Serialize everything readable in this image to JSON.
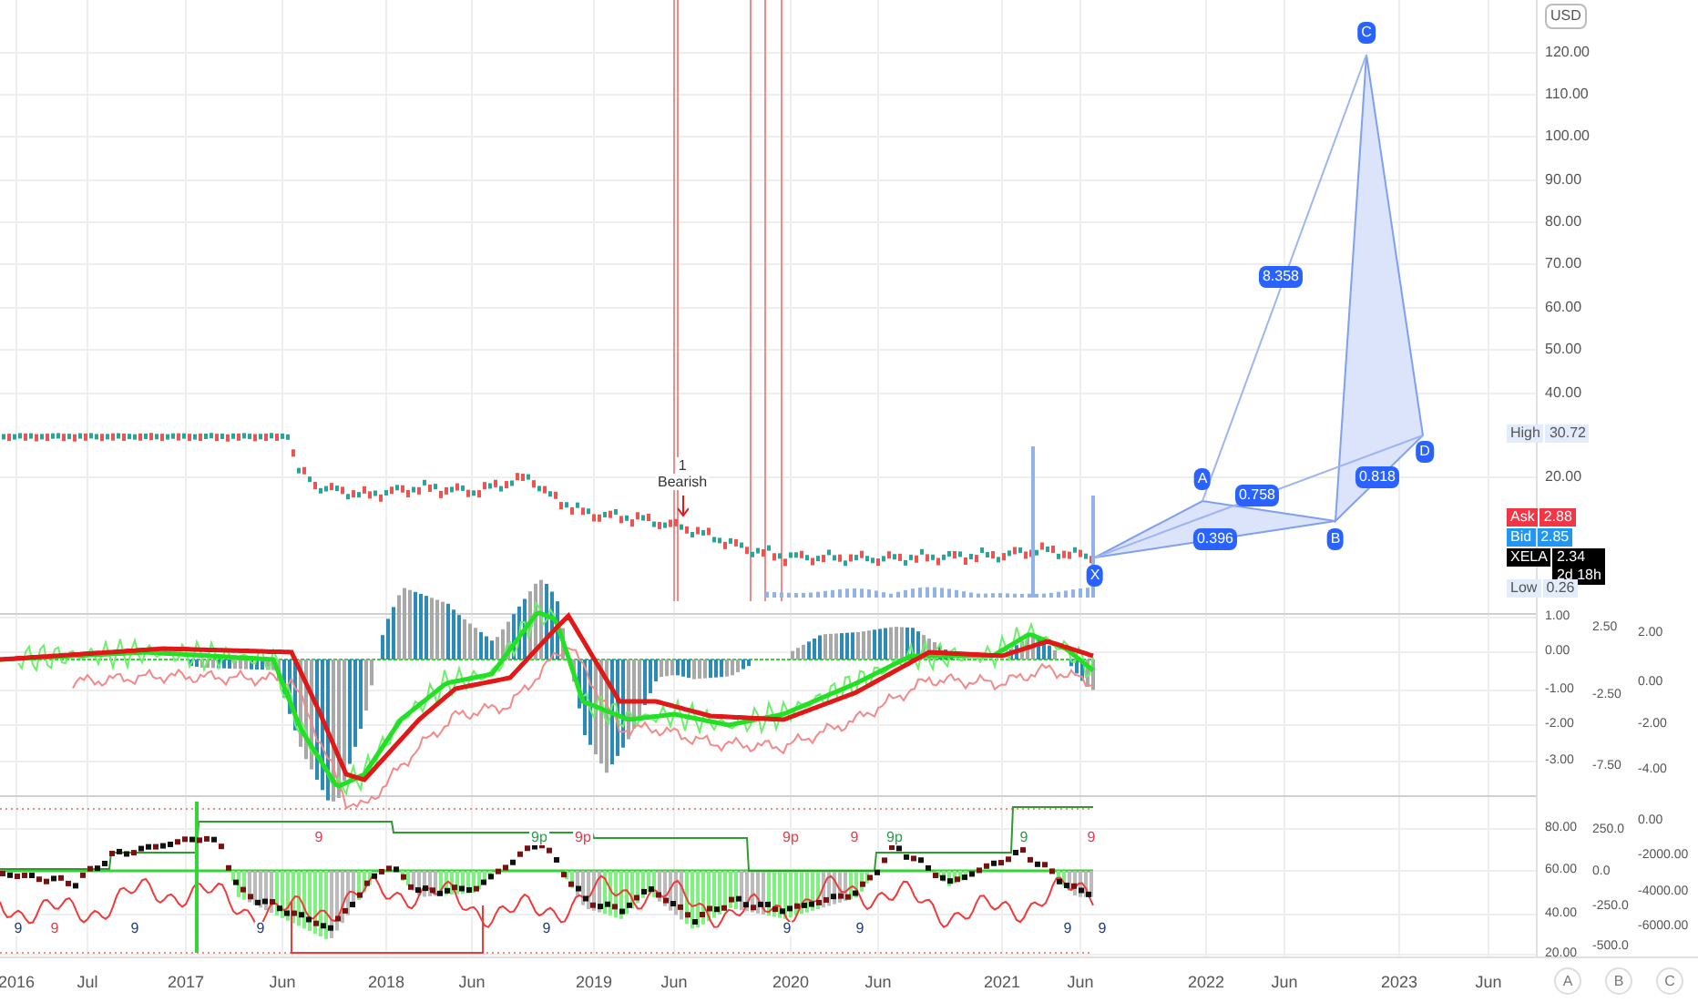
{
  "price_axis": {
    "currency": "USD",
    "ticks": [
      "120.00",
      "110.00",
      "100.00",
      "90.00",
      "80.00",
      "70.00",
      "60.00",
      "50.00",
      "40.00",
      "20.00"
    ]
  },
  "price_labels": [
    {
      "kind": "high",
      "name": "High",
      "value": "30.72"
    },
    {
      "kind": "ask",
      "name": "Ask",
      "value": "2.88"
    },
    {
      "kind": "bid",
      "name": "Bid",
      "value": "2.85"
    },
    {
      "kind": "last",
      "name": "XELA",
      "value": "2.34",
      "countdown": "2d 18h"
    },
    {
      "kind": "low",
      "name": "Low",
      "value": "0.26"
    }
  ],
  "pattern": {
    "points": [
      "X",
      "A",
      "B",
      "C",
      "D"
    ],
    "ratios": [
      "8.358",
      "0.758",
      "0.396",
      "0.818"
    ]
  },
  "signal": {
    "count": "1",
    "label": "Bearish"
  },
  "indicator_1": {
    "axes": [
      [
        "1.00",
        "0.00",
        "-1.00",
        "-2.00",
        "-3.00"
      ],
      [
        "2.50",
        "-2.50",
        "-7.50"
      ],
      [
        "2.00",
        "0.00",
        "-2.00",
        "-4.00"
      ]
    ]
  },
  "indicator_2": {
    "axes": [
      [
        "80.00",
        "60.00",
        "40.00",
        "20.00"
      ],
      [
        "250.0",
        "0.0",
        "-250.0",
        "-500.0"
      ],
      [
        "0.00",
        "-2000.00",
        "-4000.00",
        "-6000.00"
      ]
    ],
    "markers": [
      {
        "label": "9",
        "color": "#f23645"
      },
      {
        "label": "9p",
        "color": "#22a34a"
      },
      {
        "label": "9p",
        "color": "#f23645"
      },
      {
        "label": "9p",
        "color": "#f23645"
      },
      {
        "label": "9",
        "color": "#f23645"
      },
      {
        "label": "9p",
        "color": "#22a34a"
      },
      {
        "label": "9",
        "color": "#22a34a"
      },
      {
        "label": "9",
        "color": "#f23645"
      },
      {
        "label": "9",
        "color": "#1e3a8a"
      },
      {
        "label": "9",
        "color": "#f23645"
      },
      {
        "label": "9",
        "color": "#1e3a8a"
      },
      {
        "label": "9",
        "color": "#1e3a8a"
      },
      {
        "label": "9",
        "color": "#1e3a8a"
      },
      {
        "label": "9",
        "color": "#1e3a8a"
      },
      {
        "label": "9",
        "color": "#1e3a8a"
      },
      {
        "label": "9",
        "color": "#1e3a8a"
      },
      {
        "label": "9",
        "color": "#1e3a8a"
      }
    ]
  },
  "time_axis": [
    "2016",
    "Jul",
    "2017",
    "Jun",
    "2018",
    "Jun",
    "2019",
    "Jun",
    "2020",
    "Jun",
    "2021",
    "Jun",
    "2022",
    "Jun",
    "2023",
    "Jun"
  ],
  "scale_buttons": [
    "A",
    "B",
    "C"
  ]
}
